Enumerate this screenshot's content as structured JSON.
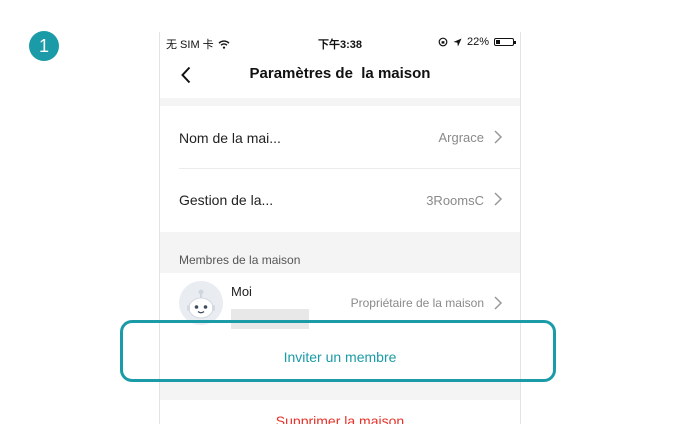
{
  "step_badge": "1",
  "status_bar": {
    "carrier": "无 SIM 卡",
    "time": "下午3:38",
    "battery": "22%",
    "battery_level": 0.22
  },
  "nav": {
    "title": "Paramètres de  la maison"
  },
  "settings": {
    "name": {
      "label": "Nom de la mai...",
      "value": "Argrace"
    },
    "management": {
      "label": "Gestion de la...",
      "value": "3RoomsC"
    }
  },
  "members": {
    "section_title": "Membres de la maison",
    "items": [
      {
        "name": "Moi",
        "role": "Propriétaire de la maison"
      }
    ]
  },
  "invite_label": "Inviter un membre",
  "delete_label": "Supprimer la maison",
  "colors": {
    "accent": "#1b9ba8",
    "danger": "#e5332a"
  }
}
